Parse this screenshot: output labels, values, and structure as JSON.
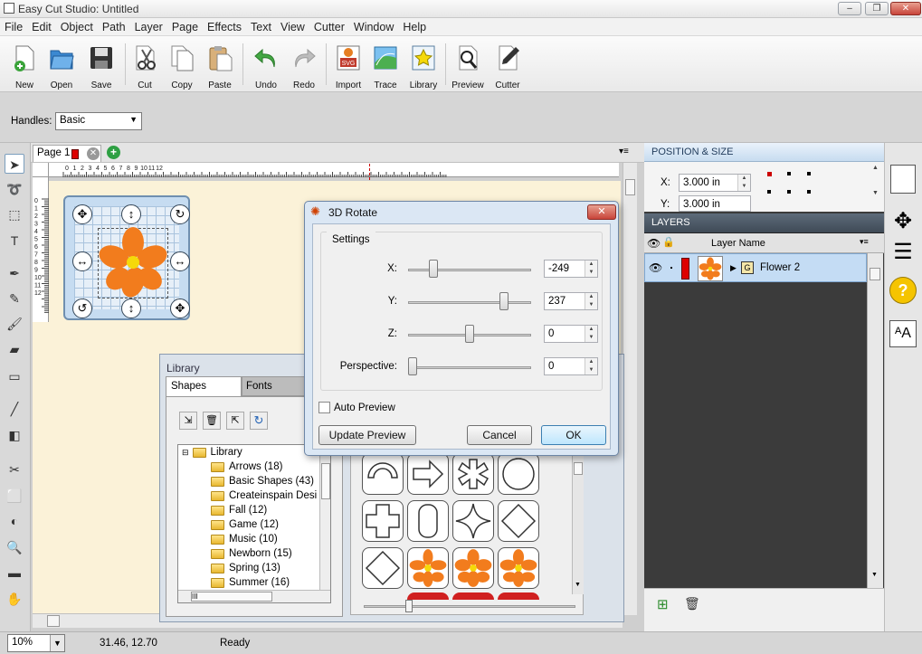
{
  "window": {
    "title": "Easy Cut Studio: Untitled",
    "min": "0",
    "max": "1",
    "close": "r"
  },
  "menu": [
    "File",
    "Edit",
    "Object",
    "Path",
    "Layer",
    "Page",
    "Effects",
    "Text",
    "View",
    "Cutter",
    "Window",
    "Help"
  ],
  "toolbar": [
    "New",
    "Open",
    "Save",
    "Cut",
    "Copy",
    "Paste",
    "Undo",
    "Redo",
    "Import",
    "Trace",
    "Library",
    "Preview",
    "Cutter"
  ],
  "options": {
    "handles_label": "Handles:",
    "handles_value": "Basic"
  },
  "doc": {
    "tab_label": "Page 1",
    "ruler_h": [
      "0",
      "1",
      "2",
      "3",
      "4",
      "5",
      "6",
      "7",
      "8",
      "9",
      "10",
      "11",
      "12"
    ],
    "ruler_v": [
      "0",
      "1",
      "2",
      "3",
      "4",
      "5",
      "6",
      "7",
      "8",
      "9",
      "10",
      "11",
      "12"
    ]
  },
  "position_size": {
    "header": "POSITION & SIZE",
    "x_label": "X:",
    "x_value": "3.000 in",
    "y_label": "Y:",
    "y_value": "3.000 in"
  },
  "layers": {
    "header": "LAYERS",
    "column": "Layer Name",
    "item": "Flower 2"
  },
  "dialog": {
    "title": "3D Rotate",
    "group": "Settings",
    "x_label": "X:",
    "x_value": "-249",
    "x_level": 0.18,
    "y_label": "Y:",
    "y_value": "237",
    "y_level": 0.8,
    "z_label": "Z:",
    "z_value": "0",
    "z_level": 0.5,
    "p_label": "Perspective:",
    "p_value": "0",
    "p_level": 0.0,
    "auto_preview": "Auto Preview",
    "update": "Update Preview",
    "cancel": "Cancel",
    "ok": "OK"
  },
  "library": {
    "title": "Library",
    "tabs": [
      "Shapes",
      "Fonts"
    ],
    "tree_root": "Library",
    "items": [
      "Arrows (18)",
      "Basic Shapes (43)",
      "Createinspain Desi",
      "Fall (12)",
      "Game (12)",
      "Music (10)",
      "Newborn (15)",
      "Spring (13)",
      "Summer (16)"
    ],
    "hscroll_label": "III"
  },
  "status": {
    "zoom": "10%",
    "coords": "31.46, 12.70",
    "state": "Ready"
  },
  "colors": {
    "flower": "#f27c1d",
    "flower_center": "#f5d90a",
    "selection": "#c6dcf1",
    "page": "#fbf2d8"
  }
}
